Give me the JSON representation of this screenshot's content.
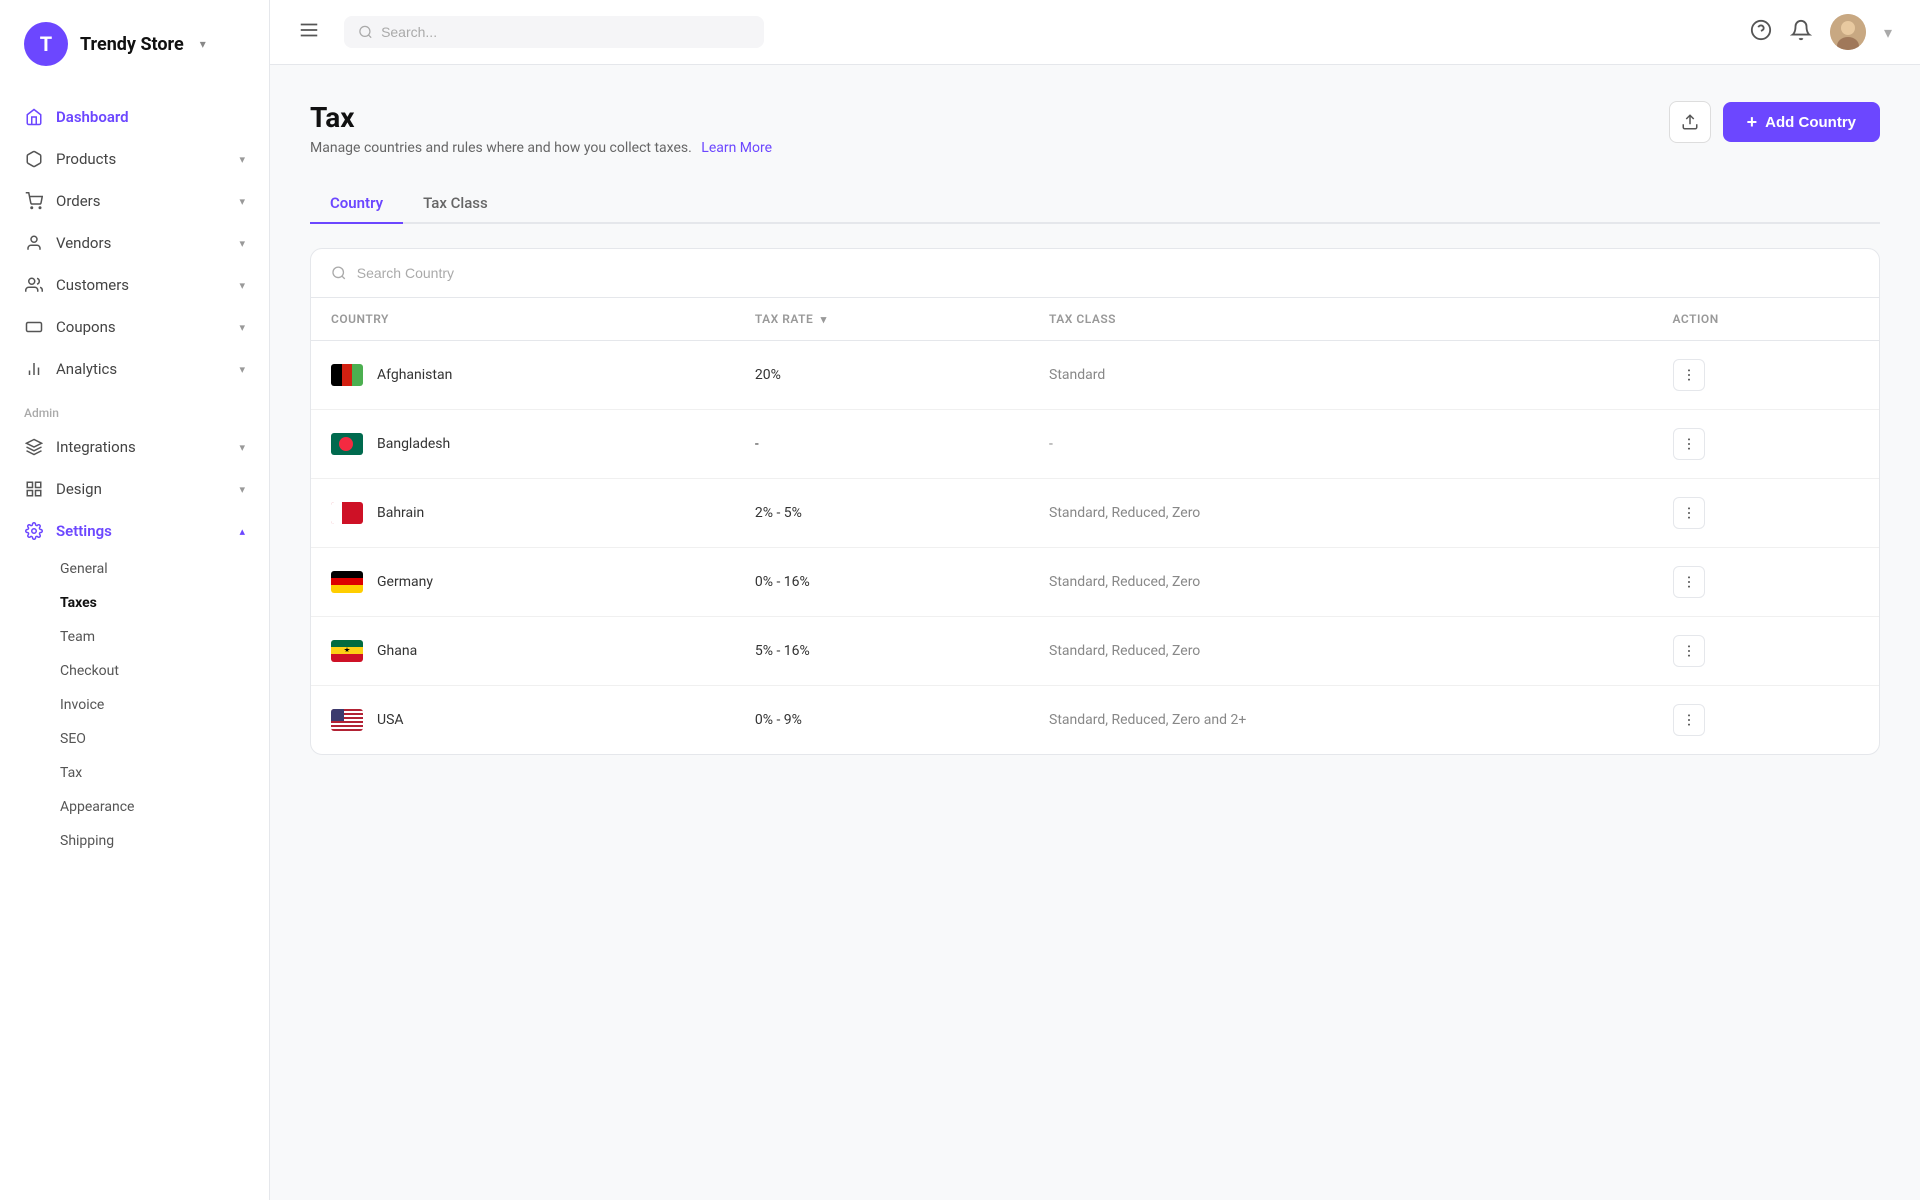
{
  "app": {
    "logo_letter": "T",
    "store_name": "Trendy Store"
  },
  "sidebar": {
    "nav_items": [
      {
        "id": "dashboard",
        "label": "Dashboard",
        "icon": "home",
        "active": false
      },
      {
        "id": "products",
        "label": "Products",
        "icon": "box",
        "has_chevron": true,
        "active": false
      },
      {
        "id": "orders",
        "label": "Orders",
        "icon": "cart",
        "has_chevron": true,
        "active": false
      },
      {
        "id": "vendors",
        "label": "Vendors",
        "icon": "person",
        "has_chevron": true,
        "active": false
      },
      {
        "id": "customers",
        "label": "Customers",
        "icon": "people",
        "has_chevron": true,
        "active": false
      },
      {
        "id": "coupons",
        "label": "Coupons",
        "icon": "ticket",
        "has_chevron": true,
        "active": false
      },
      {
        "id": "analytics",
        "label": "Analytics",
        "icon": "chart",
        "has_chevron": true,
        "active": false
      }
    ],
    "admin_label": "Admin",
    "admin_items": [
      {
        "id": "integrations",
        "label": "Integrations",
        "icon": "layers",
        "has_chevron": true,
        "active": false
      },
      {
        "id": "design",
        "label": "Design",
        "icon": "grid",
        "has_chevron": true,
        "active": false
      },
      {
        "id": "settings",
        "label": "Settings",
        "icon": "gear",
        "has_chevron": true,
        "active": true
      }
    ],
    "sub_items": [
      {
        "id": "general",
        "label": "General",
        "active": false
      },
      {
        "id": "taxes",
        "label": "Taxes",
        "active": true
      },
      {
        "id": "team",
        "label": "Team",
        "active": false
      },
      {
        "id": "checkout",
        "label": "Checkout",
        "active": false
      },
      {
        "id": "invoice",
        "label": "Invoice",
        "active": false
      },
      {
        "id": "seo",
        "label": "SEO",
        "active": false
      },
      {
        "id": "tax",
        "label": "Tax",
        "active": false
      },
      {
        "id": "appearance",
        "label": "Appearance",
        "active": false
      },
      {
        "id": "shipping",
        "label": "Shipping",
        "active": false
      }
    ]
  },
  "topbar": {
    "search_placeholder": "Search..."
  },
  "page": {
    "title": "Tax",
    "description": "Manage countries and rules where and how you collect taxes.",
    "learn_more": "Learn More",
    "add_button": "Add Country",
    "tabs": [
      {
        "id": "country",
        "label": "Country",
        "active": true
      },
      {
        "id": "tax-class",
        "label": "Tax Class",
        "active": false
      }
    ],
    "search_placeholder": "Search Country",
    "table": {
      "headers": [
        {
          "id": "country",
          "label": "COUNTRY"
        },
        {
          "id": "tax-rate",
          "label": "TAX RATE",
          "sortable": true
        },
        {
          "id": "tax-class",
          "label": "TAX CLASS"
        },
        {
          "id": "action",
          "label": "ACTION"
        }
      ],
      "rows": [
        {
          "id": "afghanistan",
          "flag": "af",
          "name": "Afghanistan",
          "tax_rate": "20%",
          "tax_class": "Standard"
        },
        {
          "id": "bangladesh",
          "flag": "bd",
          "name": "Bangladesh",
          "tax_rate": "-",
          "tax_class": "-"
        },
        {
          "id": "bahrain",
          "flag": "bh",
          "name": "Bahrain",
          "tax_rate": "2% - 5%",
          "tax_class": "Standard, Reduced, Zero"
        },
        {
          "id": "germany",
          "flag": "de",
          "name": "Germany",
          "tax_rate": "0% - 16%",
          "tax_class": "Standard, Reduced, Zero"
        },
        {
          "id": "ghana",
          "flag": "gh",
          "name": "Ghana",
          "tax_rate": "5% - 16%",
          "tax_class": "Standard, Reduced, Zero"
        },
        {
          "id": "usa",
          "flag": "us",
          "name": "USA",
          "tax_rate": "0% - 9%",
          "tax_class": "Standard, Reduced, Zero and 2+"
        }
      ]
    }
  }
}
